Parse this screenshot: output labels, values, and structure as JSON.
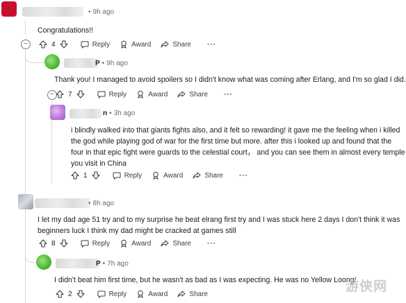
{
  "comments": [
    {
      "username_suffix": "",
      "time": "9h ago",
      "text": "Congratulations!!",
      "votes": "4",
      "reply": "Reply",
      "award": "Award",
      "share": "Share",
      "more": "···"
    },
    {
      "username_suffix": "P",
      "time": "9h ago",
      "text": "Thank you! I managed to avoid spoilers so I didn't know what was coming after Erlang, and I'm so glad I did.",
      "votes": "7",
      "reply": "Reply",
      "award": "Award",
      "share": "Share",
      "more": "···"
    },
    {
      "username_suffix": "n",
      "time": "3h ago",
      "text_lines": [
        "i blindly walked into that giants fights also, and it felt so rewarding! it gave me the feeling when i killed",
        "the god while playing god of war for the first time but more. after this i looked up and found that the",
        "four in that epic fight were guards to the celestial court， and you can see them in almost every temple",
        "you visit in China"
      ],
      "votes": "1",
      "reply": "Reply",
      "award": "Award",
      "share": "Share",
      "more": "···"
    },
    {
      "username_suffix": "",
      "time": "8h ago",
      "text_lines": [
        "I let my dad age 51 try and to my surprise he beat elrang first try and I was stuck here 2 days I don't think it was",
        "beginners luck I think my dad might be cracked at games still"
      ],
      "votes": "8",
      "reply": "Reply",
      "award": "Award",
      "share": "Share",
      "more": "···"
    },
    {
      "username_suffix": "P",
      "time": "7h ago",
      "text": "I didn't beat him first time, but he wasn't as bad as I was expecting. He was no Yellow Loong!",
      "votes": "2",
      "reply": "Reply",
      "award": "Award",
      "share": "Share"
    }
  ],
  "collapse_symbol": "−",
  "sep": "•",
  "watermark": "游侠网",
  "colors": {
    "accent": "#2a2a2a",
    "meta": "#6a6a6a",
    "thread": "#d6d6d6"
  }
}
